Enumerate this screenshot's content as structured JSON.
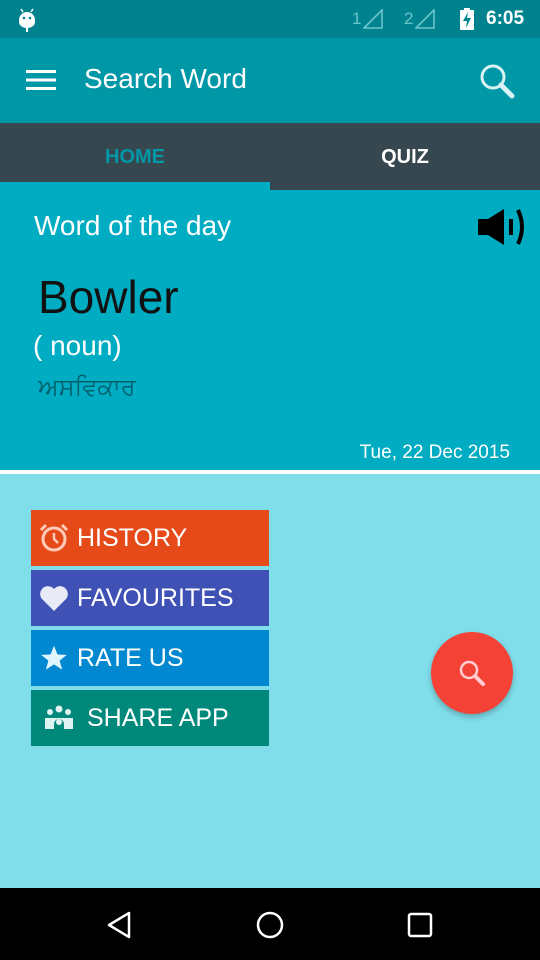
{
  "status_bar": {
    "sim1_label": "1",
    "sim2_label": "2",
    "time": "6:05",
    "icons": [
      "android-notification-icon",
      "signal-sim1-icon",
      "signal-sim2-icon",
      "battery-charging-icon"
    ]
  },
  "app_bar": {
    "title": "Search Word",
    "menu_icon": "hamburger-menu-icon",
    "search_icon": "search-icon"
  },
  "tabs": [
    {
      "label": "HOME",
      "active": true
    },
    {
      "label": "QUIZ",
      "active": false
    }
  ],
  "word_of_the_day": {
    "label": "Word of the day",
    "word": "Bowler",
    "part_of_speech": "( noun)",
    "translation": "ਅਸਵਿਕਾਰ",
    "date": "Tue, 22 Dec 2015",
    "speaker_icon": "speaker-icon"
  },
  "menu": [
    {
      "label": "HISTORY",
      "icon": "alarm-clock-icon",
      "color": "#e64a19"
    },
    {
      "label": "FAVOURITES",
      "icon": "heart-icon",
      "color": "#3f51b5"
    },
    {
      "label": "RATE US",
      "icon": "star-icon",
      "color": "#0288d1"
    },
    {
      "label": "SHARE APP",
      "icon": "people-group-icon",
      "color": "#00897b"
    }
  ],
  "fab": {
    "icon": "search-icon",
    "color": "#f44336"
  },
  "nav_bar": {
    "icons": [
      "back-icon",
      "home-icon",
      "recents-icon"
    ]
  },
  "colors": {
    "status_bar": "#00838f",
    "app_bar": "#0097a7",
    "tab_bar": "#37474f",
    "card": "#00acc1",
    "background": "#80deea"
  }
}
